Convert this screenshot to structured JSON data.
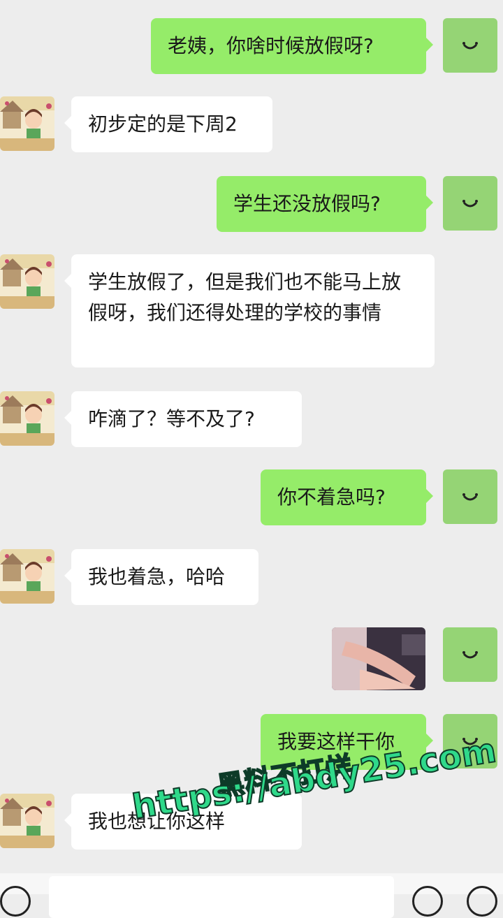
{
  "colors": {
    "background": "#ededed",
    "outgoing_bubble": "#95ec69",
    "incoming_bubble": "#ffffff",
    "self_avatar": "#95d475",
    "watermark": "#2fd98a"
  },
  "messages": [
    {
      "side": "out",
      "text": "老姨，你啥时候放假呀?"
    },
    {
      "side": "in",
      "text": "初步定的是下周2"
    },
    {
      "side": "out",
      "text": "学生还没放假吗?"
    },
    {
      "side": "in",
      "text": "学生放假了，但是我们也不能马上放假呀，我们还得处理的学校的事情"
    },
    {
      "side": "in",
      "text": "咋滴了？等不及了?"
    },
    {
      "side": "out",
      "text": "你不着急吗?"
    },
    {
      "side": "in",
      "text": "我也着急，哈哈"
    },
    {
      "side": "out",
      "type": "image",
      "icon": "photo-thumbnail"
    },
    {
      "side": "out",
      "text": "我要这样干你"
    },
    {
      "side": "in",
      "text": "我也想让你这样"
    }
  ],
  "watermark": {
    "line1": "黑料不打烊",
    "line2": "https://abdy25.com"
  },
  "input_bar": {
    "voice_icon": "voice-icon",
    "emoji_icon": "emoji-icon",
    "plus_icon": "plus-icon"
  }
}
